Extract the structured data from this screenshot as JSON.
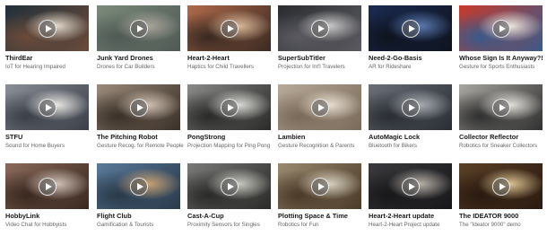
{
  "projects": [
    {
      "title": "ThirdEar",
      "subtitle": "IoT for Hearing Impaired",
      "colors": [
        "#20303a",
        "#e0d6c8",
        "#6a4a3a"
      ]
    },
    {
      "title": "Junk Yard Drones",
      "subtitle": "Drones for Car Builders",
      "colors": [
        "#7b8a7a",
        "#a9a49a",
        "#4f5a55"
      ]
    },
    {
      "title": "Heart-2-Heart",
      "subtitle": "Haptics for Child Travellers",
      "colors": [
        "#b06a4a",
        "#d8b89a",
        "#3a2a22"
      ]
    },
    {
      "title": "SuperSubTitler",
      "subtitle": "Projection for Int'l Travelers",
      "colors": [
        "#2a2c30",
        "#c8c8c8",
        "#5a5a60"
      ]
    },
    {
      "title": "Need-2-Go-Basis",
      "subtitle": "AR for Rideshare",
      "colors": [
        "#1a2a50",
        "#5a7ab0",
        "#0f1420"
      ]
    },
    {
      "title": "Whose Sign Is It Anyway?!",
      "subtitle": "Gesture for Sports Enthusiasts",
      "colors": [
        "#c83a2a",
        "#e8e4dc",
        "#3a5a8a"
      ]
    },
    {
      "title": "STFU",
      "subtitle": "Sound for Home Buyers",
      "colors": [
        "#8a8f98",
        "#e8e6e2",
        "#3a3f48"
      ]
    },
    {
      "title": "The Pitching Robot",
      "subtitle": "Gesture Recog. for Remote People",
      "colors": [
        "#9a8a7a",
        "#d0c0b0",
        "#3a3028"
      ]
    },
    {
      "title": "PongStrong",
      "subtitle": "Projection Mapping for Ping Pong",
      "colors": [
        "#8a8a88",
        "#d8d8d4",
        "#2a2a28"
      ]
    },
    {
      "title": "Lambien",
      "subtitle": "Gesture Recognition & Parents",
      "colors": [
        "#b8aa98",
        "#e6ddd0",
        "#7a6a5a"
      ]
    },
    {
      "title": "AutoMagic Lock",
      "subtitle": "Bluetooth for Bikers",
      "colors": [
        "#6a6f78",
        "#a8acb2",
        "#2a2e34"
      ]
    },
    {
      "title": "Collector Reflector",
      "subtitle": "Robotics for Sneaker Collectors",
      "colors": [
        "#a8a6a0",
        "#e0ded8",
        "#303030"
      ]
    },
    {
      "title": "HobbyLink",
      "subtitle": "Video Chat for Hobbyists",
      "colors": [
        "#8a6a5a",
        "#cfc2b8",
        "#3a2820"
      ]
    },
    {
      "title": "Flight Club",
      "subtitle": "Gamification & Tourists",
      "colors": [
        "#5a7a9a",
        "#c8a070",
        "#2a3a4a"
      ]
    },
    {
      "title": "Cast-A-Cup",
      "subtitle": "Proximity Sensors for Singles",
      "colors": [
        "#7a7a78",
        "#c8c8c0",
        "#2a2a28"
      ]
    },
    {
      "title": "Plotting Space & Time",
      "subtitle": "Robotics for Fun",
      "colors": [
        "#9a8a70",
        "#d8d0c0",
        "#4a3a28"
      ]
    },
    {
      "title": "Heart-2-Heart update",
      "subtitle": "Heart-2-Heart Project update",
      "colors": [
        "#3a3a3e",
        "#b8b0a8",
        "#18181a"
      ]
    },
    {
      "title": "The IDEATOR 9000",
      "subtitle": "The \"Ideator 9000\" demo",
      "colors": [
        "#5a4028",
        "#d8c090",
        "#2a1a10"
      ]
    }
  ]
}
